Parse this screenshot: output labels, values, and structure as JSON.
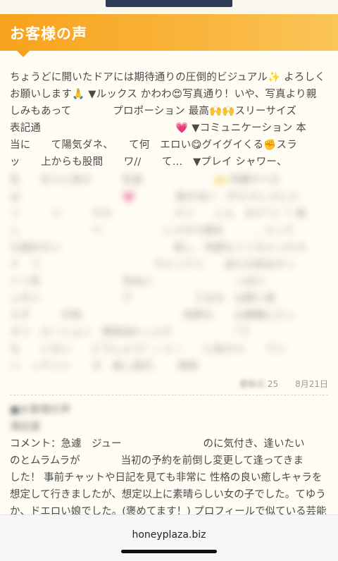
{
  "header": {
    "title": "お客様の声"
  },
  "review1": {
    "visible_lines": [
      "ちょうどに開いたドアには期待通りの圧倒的ビジュアル✨ よろしく",
      "お願いします🙏 ▼ルックス かわわ😍写真通り！いや、写真より親",
      "しみもあって　　　　プロポーション 最高🙌🙌スリーサイズ",
      "表記通　　　　　　　　　　　　　💗 ▼コミュニケーション 本",
      "当に　　て陽気ダネ、　　て何　エロい😋グイグイくる✊スラ",
      "ッ　　上からも股間　　ワ//　　て…　▼プレイ シャワー、",
      "乳　　先うと見せ　　　乳首　　　　　　　🙌 特筆すべき"
    ],
    "blurred_lines": [
      "は　　　　　　　　　　💗　　　　抱き合い　がらマレメにス",
      "リ　　　つ　　　ヤか　　　　　　スリ　　こん　のアリ！？楽",
      "し　　　　　　　ベ　　　　　　レメから顔を　　　、とって",
      "も舐めかい　　　　　　　　　　　良し、何度もイッちゃったカ",
      "ナ　フ　　　　　　　　　　　でビックリ　　送える前はネッ",
      "トリ系　　　　　　　　完全に　　　　　　　　っぱジ",
      "ュボジ　　　　　　　　で　　　　　　うなの　は勢い衰",
      "えず　　　が我　　　　　　　　　　肉厚な　　は素敵にピッ",
      "タリ　ローション　潤滑油たっぷり　　　　　　「で",
      "も　　いない　　どうしよう！」と一　　に私から　　てい",
      "ハ　ッテンシ　　タ　楽し過ぎ、　　風俗"
    ],
    "updated_label": "更新日",
    "updated_date": "2025年8月21日",
    "updated_visible": "25　　8月21日"
  },
  "review2": {
    "heading_blur": "■お客様の声",
    "satisfaction_blur": "満足度",
    "comment_lines": [
      "コメント：急遽　ジュー　　　　　　　　のに気付き、逢いたい",
      "のとムラムラが　　　　当初の予約を前倒し変更して逢ってきま",
      "した！ 事前チャットや日記を見ても非常に 性格の良い癒しキャラを",
      "想定して行きましたが、想定以上に素晴らしい女の子でした。てゆう",
      "か、ドエロい娘でした。(褒めてます！) プロフィールで似ている芸能"
    ]
  },
  "footer": {
    "domain": "honeyplaza.biz"
  }
}
